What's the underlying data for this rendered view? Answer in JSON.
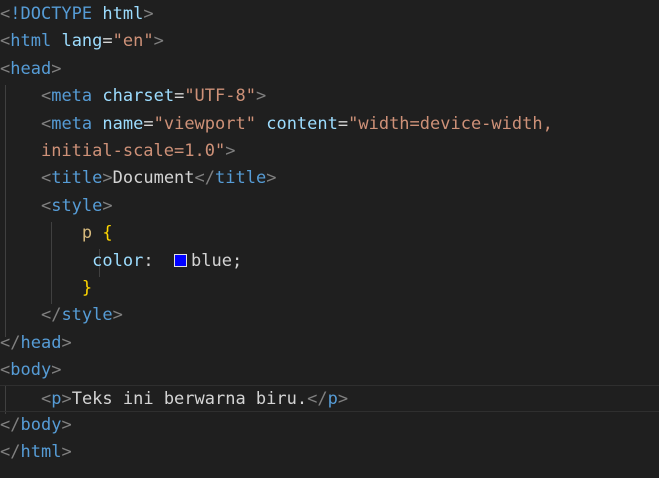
{
  "editor": {
    "background": "#1f1f1f",
    "current_line": 15,
    "lines": [
      [
        [
          "punc",
          "<"
        ],
        [
          "tag",
          "!DOCTYPE"
        ],
        [
          "text",
          " "
        ],
        [
          "attr",
          "html"
        ],
        [
          "punc",
          ">"
        ]
      ],
      [
        [
          "punc",
          "<"
        ],
        [
          "tag",
          "html"
        ],
        [
          "text",
          " "
        ],
        [
          "attr",
          "lang"
        ],
        [
          "text",
          "="
        ],
        [
          "str",
          "\"en\""
        ],
        [
          "punc",
          ">"
        ]
      ],
      [
        [
          "punc",
          "<"
        ],
        [
          "tag",
          "head"
        ],
        [
          "punc",
          ">"
        ]
      ],
      [
        [
          "text",
          "    "
        ],
        [
          "punc",
          "<"
        ],
        [
          "tag",
          "meta"
        ],
        [
          "text",
          " "
        ],
        [
          "attr",
          "charset"
        ],
        [
          "text",
          "="
        ],
        [
          "str",
          "\"UTF-8\""
        ],
        [
          "punc",
          ">"
        ]
      ],
      [
        [
          "text",
          "    "
        ],
        [
          "punc",
          "<"
        ],
        [
          "tag",
          "meta"
        ],
        [
          "text",
          " "
        ],
        [
          "attr",
          "name"
        ],
        [
          "text",
          "="
        ],
        [
          "str",
          "\"viewport\""
        ],
        [
          "text",
          " "
        ],
        [
          "attr",
          "content"
        ],
        [
          "text",
          "="
        ],
        [
          "str",
          "\"width=device-width,"
        ]
      ],
      [
        [
          "text",
          "    "
        ],
        [
          "str",
          "initial-scale=1.0\""
        ],
        [
          "punc",
          ">"
        ]
      ],
      [
        [
          "text",
          "    "
        ],
        [
          "punc",
          "<"
        ],
        [
          "tag",
          "title"
        ],
        [
          "punc",
          ">"
        ],
        [
          "text",
          "Document"
        ],
        [
          "punc",
          "</"
        ],
        [
          "tag",
          "title"
        ],
        [
          "punc",
          ">"
        ]
      ],
      [
        [
          "text",
          "    "
        ],
        [
          "punc",
          "<"
        ],
        [
          "tag",
          "style"
        ],
        [
          "punc",
          ">"
        ]
      ],
      [
        [
          "text",
          "        "
        ],
        [
          "sel",
          "p"
        ],
        [
          "text",
          " "
        ],
        [
          "brace",
          "{"
        ]
      ],
      [
        [
          "text",
          "         "
        ],
        [
          "prop",
          "color"
        ],
        [
          "text",
          ":  "
        ],
        [
          "swatch",
          "blue"
        ],
        [
          "text",
          "blue;"
        ]
      ],
      [
        [
          "text",
          "        "
        ],
        [
          "brace",
          "}"
        ]
      ],
      [
        [
          "text",
          "    "
        ],
        [
          "punc",
          "</"
        ],
        [
          "tag",
          "style"
        ],
        [
          "punc",
          ">"
        ]
      ],
      [
        [
          "punc",
          "</"
        ],
        [
          "tag",
          "head"
        ],
        [
          "punc",
          ">"
        ]
      ],
      [
        [
          "punc",
          "<"
        ],
        [
          "tag",
          "body"
        ],
        [
          "punc",
          ">"
        ]
      ],
      [
        [
          "text",
          "    "
        ],
        [
          "punc",
          "<"
        ],
        [
          "tag",
          "p"
        ],
        [
          "punc",
          ">"
        ],
        [
          "text",
          "Teks ini berwarna biru."
        ],
        [
          "punc",
          "</"
        ],
        [
          "tag",
          "p"
        ],
        [
          "punc",
          ">"
        ]
      ],
      [
        [
          "punc",
          "</"
        ],
        [
          "tag",
          "body"
        ],
        [
          "punc",
          ">"
        ]
      ],
      [
        [
          "punc",
          "</"
        ],
        [
          "tag",
          "html"
        ],
        [
          "punc",
          ">"
        ]
      ]
    ]
  }
}
